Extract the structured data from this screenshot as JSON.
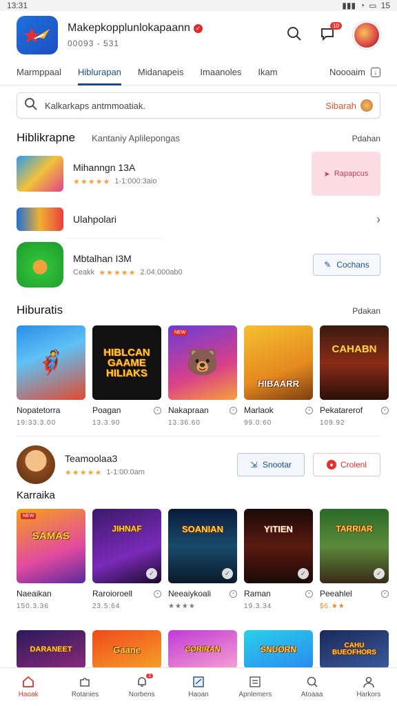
{
  "status_bar": {
    "time": "13:31",
    "battery": "15"
  },
  "header": {
    "title": "Makepkopplunlokapaann",
    "subtitle": "00093 - 531",
    "chat_badge": "10"
  },
  "tabs": [
    {
      "label": "Marmppaal"
    },
    {
      "label": "Hiblurapan"
    },
    {
      "label": "Midanapeis"
    },
    {
      "label": "Imaanoles"
    },
    {
      "label": "Ikam"
    }
  ],
  "tabs_right": {
    "label": "Noooaim"
  },
  "search": {
    "placeholder": "Kalkarkaps antmmoatiak.",
    "button": "Sibarah"
  },
  "featured": {
    "title": "Hiblikrapne",
    "subtitle": "Kantaniy Aplilepongas",
    "link": "Pdahan",
    "items": [
      {
        "name": "Mihanngn 13A",
        "stars": "★★★★★",
        "meta": "1-1:000:3aio",
        "action": "Rapapcus"
      },
      {
        "name": "Ulahpolari",
        "stars": "",
        "meta": "",
        "action": ""
      },
      {
        "name": "Mbtalhan I3M",
        "stars": "★★★★★",
        "meta": "2.04.000ab0",
        "rating_text": "Ceakk",
        "action": "Cochans"
      }
    ]
  },
  "section_games": {
    "title": "Hiburatis",
    "link": "Pdakan",
    "cards": [
      {
        "name": "Nopatetorra",
        "sub": "19:33.3.00",
        "art": ""
      },
      {
        "name": "Poagan",
        "sub": "13.3.90",
        "art": "HIBLCAN GAAME HILIAKS"
      },
      {
        "name": "Nakapraan",
        "sub": "13.36.60",
        "art": ""
      },
      {
        "name": "Marlaok",
        "sub": "99.0:60",
        "art": "HIBAARR"
      },
      {
        "name": "Pekatarerof",
        "sub": "109.92",
        "art": "CAHABN"
      }
    ]
  },
  "promo_row": {
    "name": "Teamoolaa3",
    "stars": "★★★★★",
    "meta": "1-1:00:0am",
    "btn1": "Snootar",
    "btn2": "Crolenl"
  },
  "section_more": {
    "title": "Karraika",
    "cards": [
      {
        "name": "Naeaikan",
        "sub": "150.3.36",
        "art": "SAMAS"
      },
      {
        "name": "Raroioroell",
        "sub": "23.5:64",
        "art": "JIHNAF"
      },
      {
        "name": "Neeaiykoali",
        "sub": "★★★★",
        "art": "SOANIAN"
      },
      {
        "name": "Raman",
        "sub": "19.3.34",
        "art": "YITIEN"
      },
      {
        "name": "Peeahlel",
        "sub": "$6.★★",
        "art": "TARRIAR"
      }
    ],
    "cards_row3": [
      {
        "art": "DARANEET"
      },
      {
        "art": "Gaane"
      },
      {
        "art": "CORIRAN"
      },
      {
        "art": "SNUORN"
      },
      {
        "art": "CAHU BUEOFHORS"
      }
    ]
  },
  "bottom_nav": [
    {
      "label": "Haoak",
      "icon": "home-icon",
      "active": true
    },
    {
      "label": "Rotanies",
      "icon": "puzzle-icon"
    },
    {
      "label": "Norbens",
      "icon": "bell-icon",
      "badge": "1"
    },
    {
      "label": "Haoan",
      "icon": "map-icon"
    },
    {
      "label": "Apnlemers",
      "icon": "list-icon"
    },
    {
      "label": "Atoaaa",
      "icon": "search-icon"
    },
    {
      "label": "Harkors",
      "icon": "profile-icon"
    }
  ],
  "colors": {
    "accent": "#1a4c8c",
    "red": "#d3332f",
    "star": "#f4a23c"
  }
}
